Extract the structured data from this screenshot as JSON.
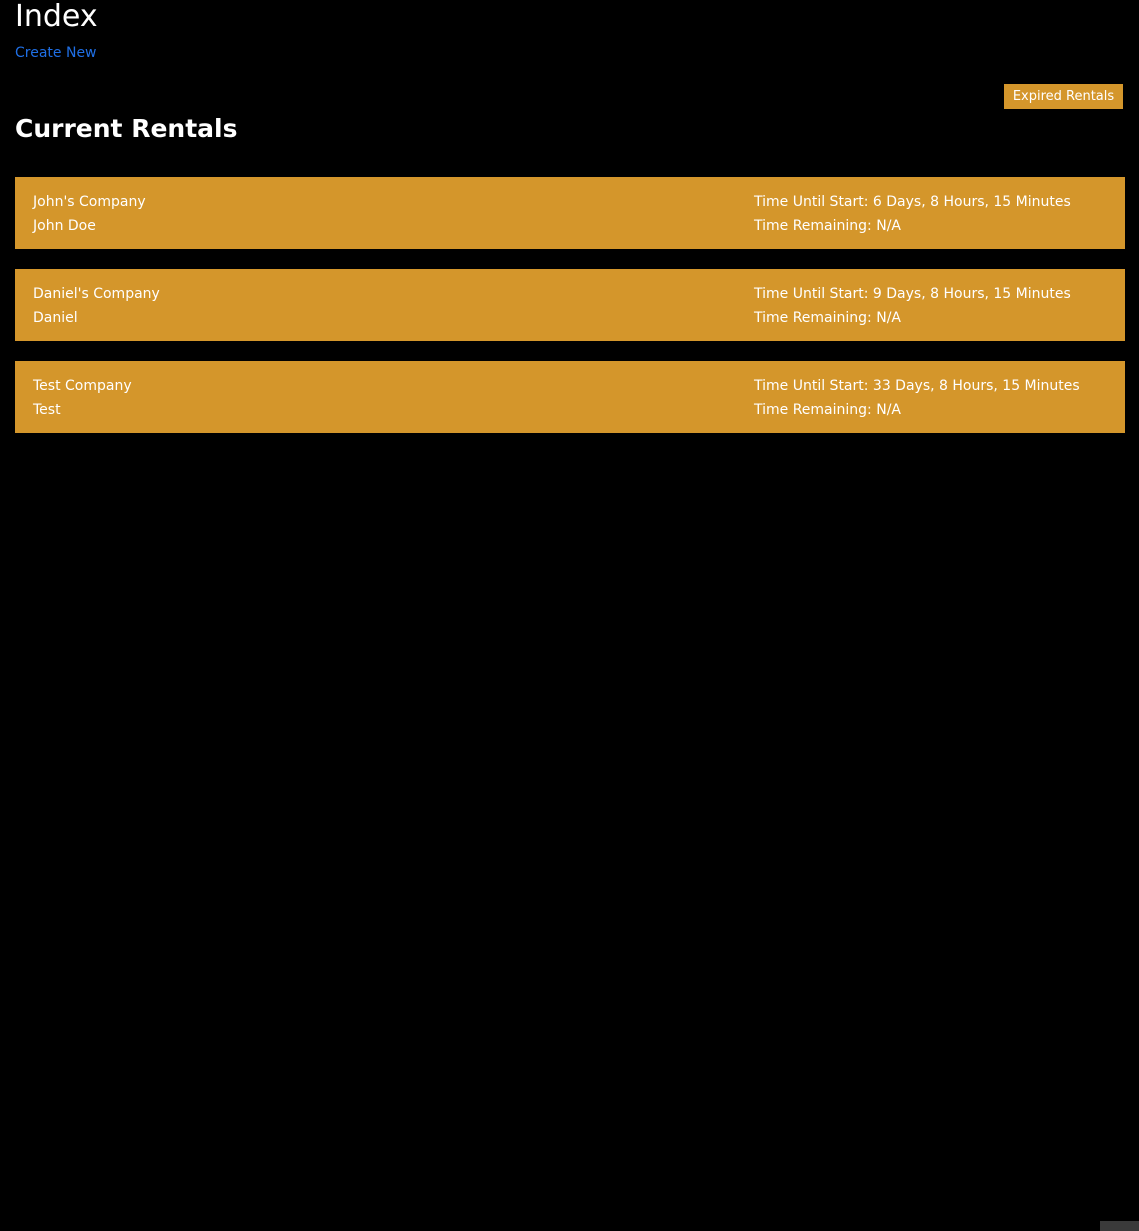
{
  "page": {
    "title": "Index",
    "create_link": "Create New",
    "expired_button": "Expired Rentals",
    "section_title": "Current Rentals"
  },
  "rentals": [
    {
      "company": "John's Company",
      "contact": "John Doe",
      "time_until_start": "Time Until Start: 6 Days, 8 Hours, 15 Minutes",
      "time_remaining": "Time Remaining: N/A"
    },
    {
      "company": "Daniel's Company",
      "contact": "Daniel",
      "time_until_start": "Time Until Start: 9 Days, 8 Hours, 15 Minutes",
      "time_remaining": "Time Remaining: N/A"
    },
    {
      "company": "Test Company",
      "contact": "Test",
      "time_until_start": "Time Until Start: 33 Days, 8 Hours, 15 Minutes",
      "time_remaining": "Time Remaining: N/A"
    }
  ],
  "colors": {
    "background": "#000000",
    "card": "#d4962b",
    "link": "#1f6fe5",
    "text": "#ffffff"
  }
}
